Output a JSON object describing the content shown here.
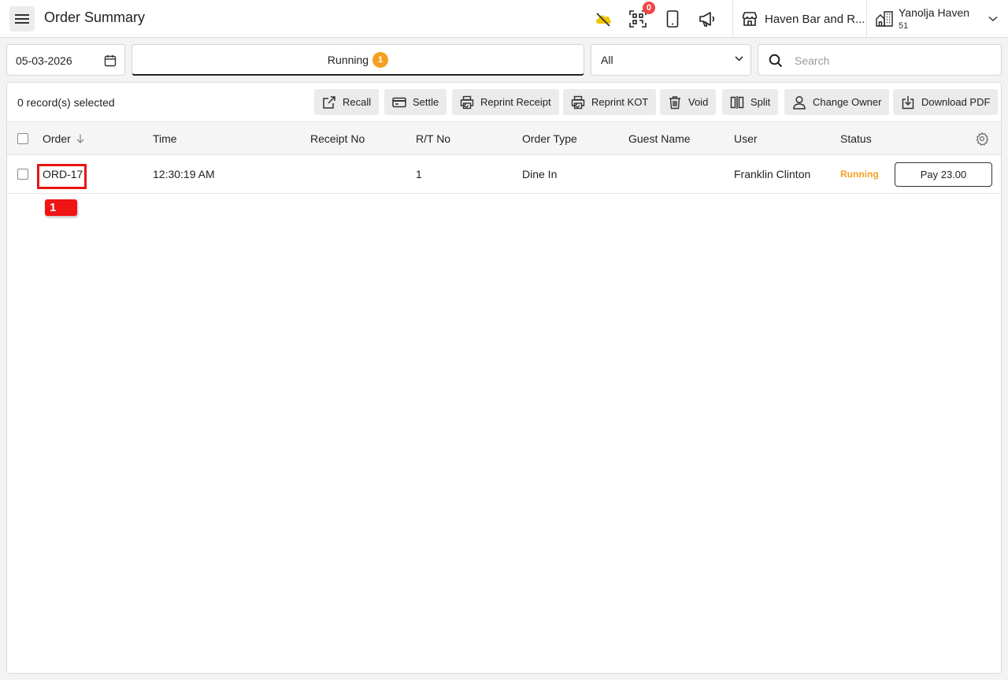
{
  "header": {
    "title": "Order Summary",
    "notification_count": "0",
    "store_name": "Haven Bar and R...",
    "org_name": "Yanolja Haven",
    "org_number": "51"
  },
  "filters": {
    "date": "05-03-2026",
    "tab_label": "Running",
    "tab_count": "1",
    "type_selected": "All",
    "search_placeholder": "Search"
  },
  "toolbar": {
    "selection_text": "0 record(s) selected",
    "buttons": [
      "Recall",
      "Settle",
      "Reprint Receipt",
      "Reprint KOT",
      "Void",
      "Split",
      "Change Owner",
      "Download PDF"
    ]
  },
  "table": {
    "columns": [
      "Order",
      "Time",
      "Receipt No",
      "R/T No",
      "Order Type",
      "Guest Name",
      "User",
      "Status"
    ],
    "rows": [
      {
        "order": "ORD-17",
        "time": "12:30:19 AM",
        "receipt_no": "",
        "rt_no": "1",
        "order_type": "Dine In",
        "guest_name": "",
        "user": "Franklin Clinton",
        "status": "Running",
        "pay_label": "Pay 23.00"
      }
    ]
  },
  "annotation": {
    "marker_label": "1"
  },
  "colors": {
    "accent_orange": "#f5a023",
    "badge_red": "#f24444",
    "highlight_red": "#e81414"
  }
}
